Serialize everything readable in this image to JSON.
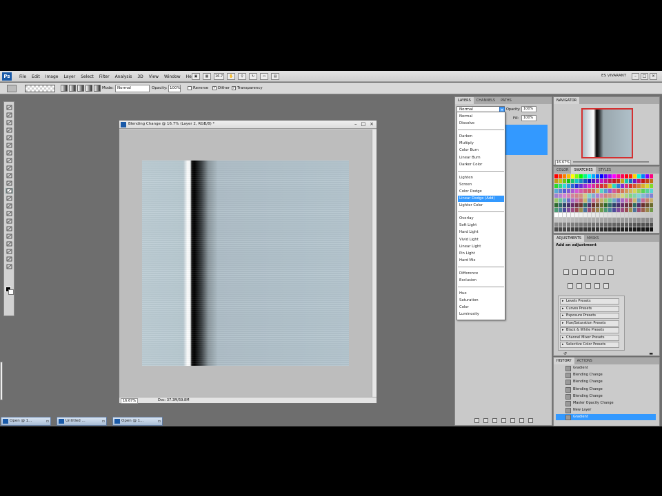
{
  "app": {
    "logo": "Ps",
    "menu": [
      "File",
      "Edit",
      "Image",
      "Layer",
      "Select",
      "Filter",
      "Analysis",
      "3D",
      "View",
      "Window",
      "Help"
    ],
    "zoom_menu": "16.7",
    "workspace": "ES VIVARANT",
    "win_controls": [
      "–",
      "□",
      "×"
    ]
  },
  "options": {
    "mode_label": "Mode:",
    "mode_value": "Normal",
    "opacity_label": "Opacity:",
    "opacity_value": "100%",
    "reverse": "Reverse",
    "dither": "Dither",
    "transparency": "Transparency"
  },
  "document": {
    "title": "Blending Change @ 16.7% (Layer 2, RGB/8) *",
    "zoom": "16.67%",
    "doc_info": "Doc: 37.3M/59.8M",
    "controls": [
      "–",
      "□",
      "×"
    ]
  },
  "layers": {
    "tabs": [
      "LAYERS",
      "CHANNELS",
      "PATHS"
    ],
    "blend_value": "Normal",
    "opacity_label": "Opacity:",
    "opacity_value": "100%",
    "fill_label": "Fill:",
    "fill_value": "100%"
  },
  "blend_modes": {
    "group1": [
      "Normal",
      "Dissolve"
    ],
    "group2": [
      "Darken",
      "Multiply",
      "Color Burn",
      "Linear Burn",
      "Darker Color"
    ],
    "group3": [
      "Lighten",
      "Screen",
      "Color Dodge",
      "Linear Dodge (Add)",
      "Lighter Color"
    ],
    "group4": [
      "Overlay",
      "Soft Light",
      "Hard Light",
      "Vivid Light",
      "Linear Light",
      "Pin Light",
      "Hard Mix"
    ],
    "group5": [
      "Difference",
      "Exclusion"
    ],
    "group6": [
      "Hue",
      "Saturation",
      "Color",
      "Luminosity"
    ],
    "highlighted": "Linear Dodge (Add)"
  },
  "navigator": {
    "tab": "NAVIGATOR",
    "zoom": "16.67%"
  },
  "swatches": {
    "tabs": [
      "COLOR",
      "SWATCHES",
      "STYLES"
    ]
  },
  "adjustments": {
    "tabs": [
      "ADJUSTMENTS",
      "MASKS"
    ],
    "title": "Add an adjustment",
    "presets": [
      "Levels Presets",
      "Curves Presets",
      "Exposure Presets",
      "Hue/Saturation Presets",
      "Black & White Presets",
      "Channel Mixer Presets",
      "Selective Color Presets"
    ]
  },
  "history": {
    "tabs": [
      "HISTORY",
      "ACTIONS"
    ],
    "items": [
      "Gradient",
      "Blending Change",
      "Blending Change",
      "Blending Change",
      "Blending Change",
      "Master Opacity Change",
      "New Layer",
      "Gradient"
    ],
    "selected_index": 7
  },
  "taskbar": {
    "items": [
      "Open @ 1...",
      "Untitled ...",
      "Open @ 1..."
    ]
  }
}
